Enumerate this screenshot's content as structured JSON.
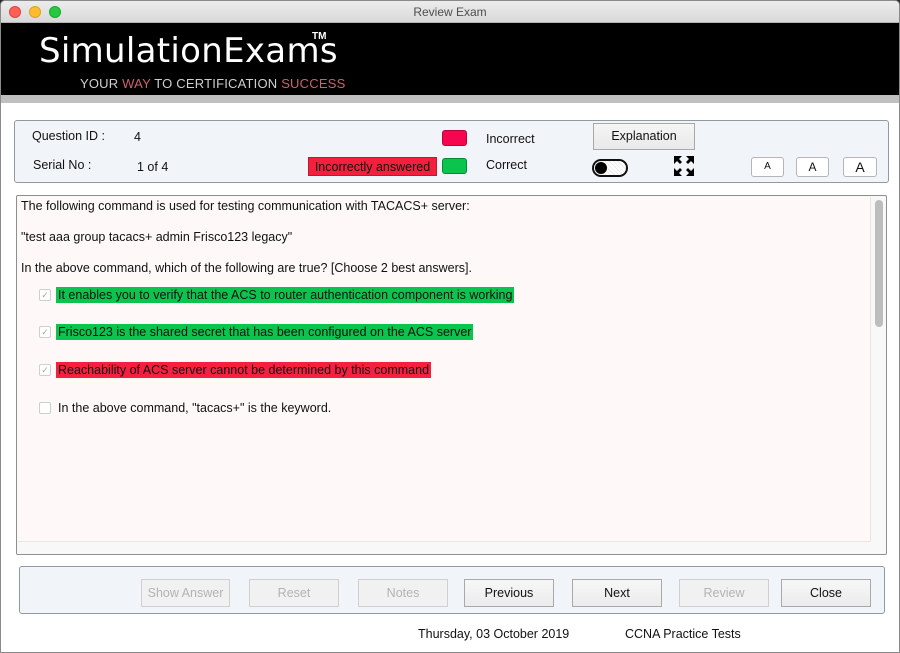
{
  "window": {
    "title": "Review Exam"
  },
  "banner": {
    "brand": "SimulationExams",
    "trademark": "TM",
    "tagline_parts": [
      "YOUR ",
      "WAY",
      " TO CERTIFICATION ",
      "SUCCESS"
    ]
  },
  "info": {
    "question_id_label": "Question ID :",
    "question_id": "4",
    "serial_label": "Serial No :",
    "serial": "1 of 4",
    "status": "Incorrectly answered",
    "legend": {
      "incorrect_label": "Incorrect",
      "incorrect_color": "#f5064f",
      "correct_label": "Correct",
      "correct_color": "#0ac44d"
    },
    "explanation_button": "Explanation",
    "toggle_state": "off",
    "font_buttons": [
      "A",
      "A",
      "A"
    ]
  },
  "question": {
    "lines": [
      "The following command is used for testing communication with TACACS+ server:",
      "\"test aaa group tacacs+ admin Frisco123 legacy\"",
      "In the above command, which of the following are true? [Choose 2 best answers]."
    ],
    "options": [
      {
        "text": "It enables you to verify that the ACS to router authentication component is working",
        "checked": true,
        "result": "correct"
      },
      {
        "text": "Frisco123 is the shared secret that has been configured on the ACS server",
        "checked": true,
        "result": "correct"
      },
      {
        "text": "Reachability of ACS server cannot be determined by this command",
        "checked": true,
        "result": "incorrect"
      },
      {
        "text": "In the above command, \"tacacs+\" is the keyword.",
        "checked": false,
        "result": "none"
      }
    ],
    "check_glyph": "✓"
  },
  "buttons": {
    "show_answer": "Show Answer",
    "reset": "Reset",
    "notes": "Notes",
    "previous": "Previous",
    "next": "Next",
    "review": "Review",
    "close": "Close"
  },
  "footer": {
    "date": "Thursday, 03 October 2019",
    "product": "CCNA Practice Tests"
  }
}
